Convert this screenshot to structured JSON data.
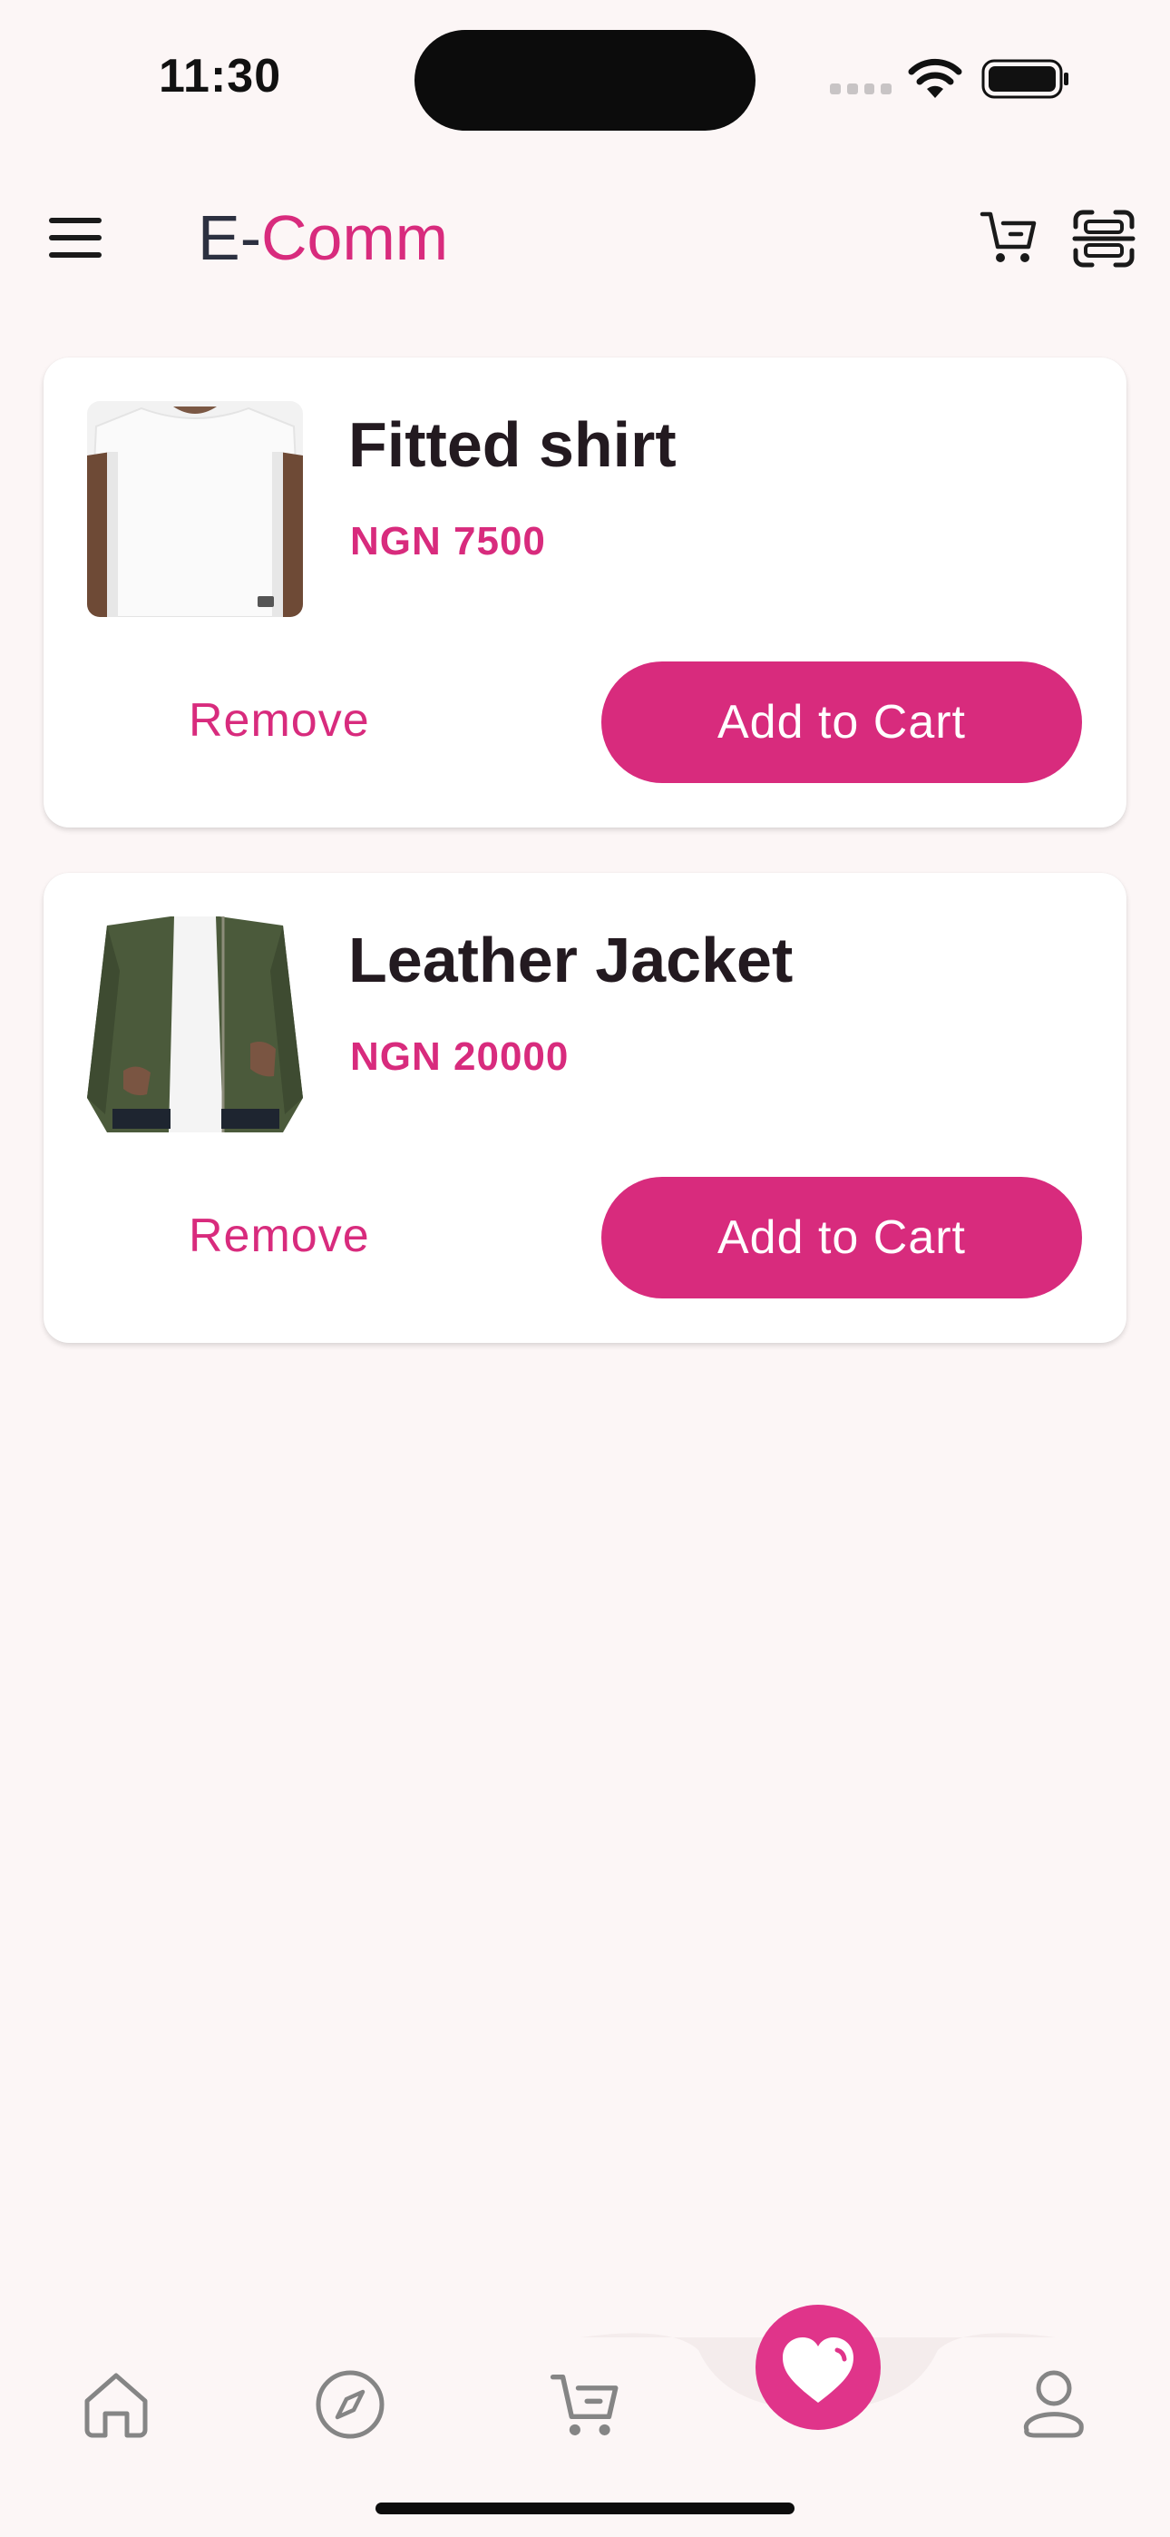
{
  "status_bar": {
    "time": "11:30"
  },
  "header": {
    "title_part1": "E-",
    "title_part2": "Comm"
  },
  "wishlist": [
    {
      "name": "Fitted shirt",
      "price": "NGN 7500",
      "remove_label": "Remove",
      "add_label": "Add to Cart",
      "image": "white-tshirt"
    },
    {
      "name": "Leather Jacket",
      "price": "NGN 20000",
      "remove_label": "Remove",
      "add_label": "Add to Cart",
      "image": "green-bomber-jacket"
    }
  ],
  "bottom_nav": {
    "items": [
      "home-icon",
      "compass-icon",
      "cart-icon",
      "heart-icon",
      "profile-icon"
    ],
    "active": "heart-icon"
  },
  "colors": {
    "accent": "#d82b7d",
    "background": "#fcf6f6",
    "card": "#ffffff"
  }
}
